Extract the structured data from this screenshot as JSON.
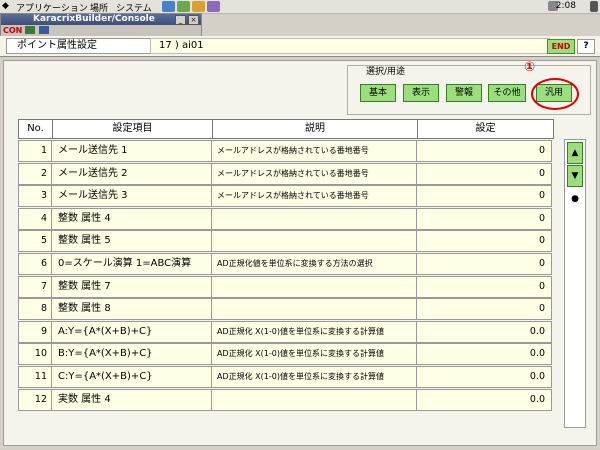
{
  "menubar": {
    "items": [
      "アプリケーション",
      "場所",
      "システム"
    ],
    "time": "2:08"
  },
  "console": {
    "title": "KaracrixBuilder/Console",
    "label": "CON"
  },
  "header": {
    "title": "ポイント属性設定",
    "record": "17 ) ai01",
    "end_label": "END",
    "help_label": "?"
  },
  "selector": {
    "label": "選択/用途",
    "buttons": [
      "基本",
      "表示",
      "警報",
      "その他",
      "汎用"
    ],
    "annotation": "①"
  },
  "table": {
    "headers": [
      "No.",
      "設定項目",
      "説明",
      "設定"
    ],
    "rows": [
      {
        "no": "1",
        "item": "メール送信先 1",
        "desc": "メールアドレスが格納されている番地番号",
        "value": "0"
      },
      {
        "no": "2",
        "item": "メール送信先 2",
        "desc": "メールアドレスが格納されている番地番号",
        "value": "0"
      },
      {
        "no": "3",
        "item": "メール送信先 3",
        "desc": "メールアドレスが格納されている番地番号",
        "value": "0"
      },
      {
        "no": "4",
        "item": "整数 属性 4",
        "desc": "",
        "value": "0"
      },
      {
        "no": "5",
        "item": "整数 属性 5",
        "desc": "",
        "value": "0"
      },
      {
        "no": "6",
        "item": "0=スケール演算 1=ABC演算",
        "desc": "AD正規化値を単位系に変換する方法の選択",
        "value": "0"
      },
      {
        "no": "7",
        "item": "整数 属性 7",
        "desc": "",
        "value": "0"
      },
      {
        "no": "8",
        "item": "整数 属性 8",
        "desc": "",
        "value": "0"
      },
      {
        "no": "9",
        "item": "A:Y={A*(X+B)+C}",
        "desc": "AD正規化 X(1-0)値を単位系に変換する計算値",
        "value": "0.0"
      },
      {
        "no": "10",
        "item": "B:Y={A*(X+B)+C}",
        "desc": "AD正規化 X(1-0)値を単位系に変換する計算値",
        "value": "0.0"
      },
      {
        "no": "11",
        "item": "C:Y={A*(X+B)+C}",
        "desc": "AD正規化 X(1-0)値を単位系に変換する計算値",
        "value": "0.0"
      },
      {
        "no": "12",
        "item": "実数 属性 4",
        "desc": "",
        "value": "0.0"
      }
    ]
  },
  "scroll": {
    "up": "▲",
    "down": "▼",
    "dot": "●"
  }
}
